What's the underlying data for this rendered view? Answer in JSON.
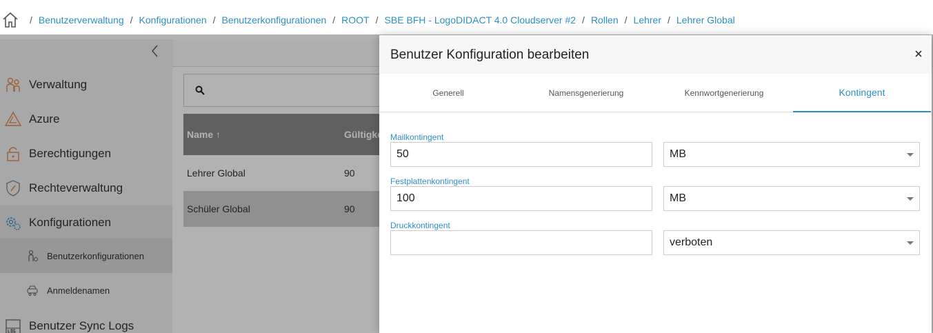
{
  "breadcrumb": {
    "items": [
      "Benutzerverwaltung",
      "Konfigurationen",
      "Benutzerkonfigurationen",
      "ROOT",
      "SBE BFH - LogoDIDACT 4.0 Cloudserver #2",
      "Rollen",
      "Lehrer",
      "Lehrer Global"
    ],
    "separator": "/"
  },
  "sidebar": {
    "items": [
      {
        "label": "Verwaltung",
        "icon": "users-icon"
      },
      {
        "label": "Azure",
        "icon": "azure-icon"
      },
      {
        "label": "Berechtigungen",
        "icon": "lock-icon"
      },
      {
        "label": "Rechteverwaltung",
        "icon": "shield-icon"
      },
      {
        "label": "Konfigurationen",
        "icon": "gears-icon"
      }
    ],
    "subitems": [
      {
        "label": "Benutzerkonfigurationen",
        "icon": "user-config-icon"
      },
      {
        "label": "Anmeldenamen",
        "icon": "login-icon"
      }
    ],
    "bottom_item": {
      "label": "Benutzer Sync Logs",
      "icon": "log-icon"
    }
  },
  "table": {
    "headers": [
      "Name ↑",
      "Gültigke"
    ],
    "rows": [
      [
        "Lehrer Global",
        "90"
      ],
      [
        "Schüler Global",
        "90"
      ]
    ]
  },
  "modal": {
    "title": "Benutzer Konfiguration bearbeiten",
    "close": "×",
    "tabs": [
      "Generell",
      "Namensgenerierung",
      "Kennwortgenerierung",
      "Kontingent"
    ],
    "active_tab": "Kontingent",
    "fields": [
      {
        "label": "Mailkontingent",
        "value": "50",
        "unit": "MB"
      },
      {
        "label": "Festplattenkontingent",
        "value": "100",
        "unit": "MB"
      },
      {
        "label": "Druckkontingent",
        "value": "",
        "unit": "verboten"
      }
    ]
  },
  "colors": {
    "accent": "#2d8fc6",
    "sidebar_bg": "#f1f1f1",
    "table_header": "#8a8a8a",
    "icon_orange": "#e2874a"
  }
}
